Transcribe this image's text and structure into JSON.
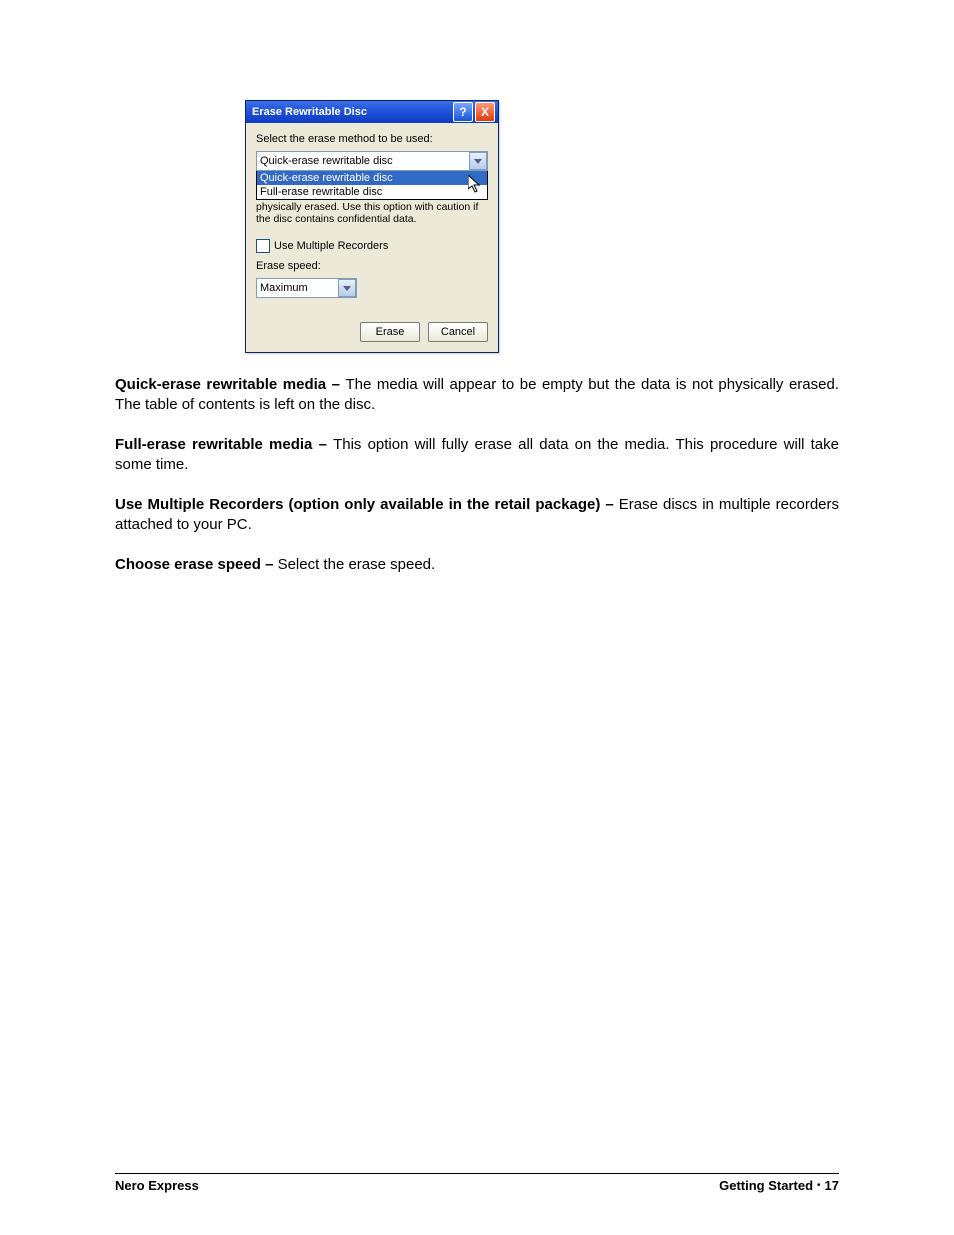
{
  "dialog": {
    "title": "Erase Rewritable Disc",
    "prompt": "Select the erase method to be used:",
    "method_selected": "Quick-erase rewritable disc",
    "dropdown_options": {
      "opt1": "Quick-erase rewritable disc",
      "opt2": "Full-erase rewritable disc"
    },
    "hint_tail": "physically erased. Use this option with caution if the disc contains confidential data.",
    "multi_recorders_label": "Use Multiple Recorders",
    "speed_label": "Erase speed:",
    "speed_value": "Maximum",
    "btn_erase": "Erase",
    "btn_cancel": "Cancel"
  },
  "body": {
    "p1_bold": "Quick-erase rewritable media – ",
    "p1_text": "The media will appear to be empty but the data is not physically erased. The table of contents is left on the disc.",
    "p2_bold": "Full-erase rewritable media – ",
    "p2_text": "This option will fully erase all data on the media. This procedure will take some time.",
    "p3_bold": "Use Multiple Recorders (option only available in the retail package) – ",
    "p3_text": "Erase discs in multiple recorders attached to your PC.",
    "p4_bold": "Choose erase speed – ",
    "p4_text": "Select the erase speed."
  },
  "footer": {
    "left": "Nero Express",
    "section": "Getting Started",
    "bullet": "•",
    "page": "17"
  }
}
